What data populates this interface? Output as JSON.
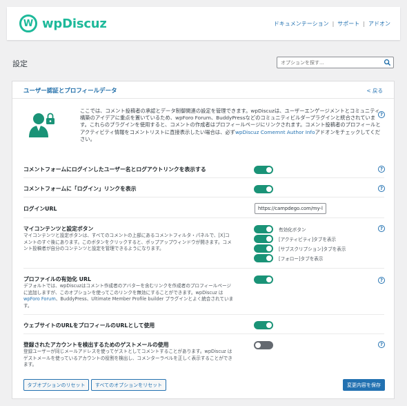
{
  "brand": {
    "name": "wpDiscuz",
    "logo_letter": "W",
    "color": "#1db99a"
  },
  "topnav": {
    "docs": "ドキュメンテーション",
    "support": "サポート",
    "addons": "アドオン"
  },
  "page": {
    "title": "設定",
    "search_placeholder": "オプションを探す..."
  },
  "panel": {
    "title": "ユーザー認証とプロフィールデータ",
    "back": "< 戻る",
    "intro": {
      "text": "ここでは、コメント投稿者の承認とデータ制御関連の設定を管理できます。wpDiscuzは、ユーザーエンゲージメントとコミュニティ構築のアイデアに重点を置いているため、wpForo Forum、BuddyPressなどのコミュニティビルダープラグインと統合されています。これらのプラグインを使用すると、コメントの作成者はプロフィールページにリンクされます。コメント投稿者のプロフィールとアクティビティ情報をコメントリストに直接表示したい場合は、必ず",
      "link": "wpDiscuz Comemnt Author Info",
      "suffix": "アドオンをチェックしてください。"
    }
  },
  "rows": {
    "r1": {
      "label": "コメントフォームにログインしたユーザー名とログアウトリンクを表示する",
      "enabled": true
    },
    "r2": {
      "label": "コメントフォームに「ログイン」リンクを表示",
      "enabled": true
    },
    "r3": {
      "label": "ログインURL",
      "value": "https://campdego.com/my-l"
    },
    "r4": {
      "label": "マイコンテンツと設定ボタン",
      "desc": "マイコンテンツと設定ボタンは、すべてのコメントの上部にあるコメントフィルタ・パネルで、[X]コメントのすぐ後にあります。このボタンをクリックすると、ポップアップウィンドウが開きます。コメント投稿者が自分のコンテンツと設定を管理できるようになります。",
      "options": [
        {
          "label": "有効化ボタン",
          "enabled": true
        },
        {
          "label": "[アクティビティ]タブを表示",
          "enabled": true
        },
        {
          "label": "[サブスクリプション]タブを表示",
          "enabled": true
        },
        {
          "label": "[フォロー]タブを表示",
          "enabled": true
        }
      ]
    },
    "r5": {
      "label": "プロファイルの有効化 URL",
      "desc_a": "デフォルトでは、wpDiscuzはコメント作成者のアバターを含むリンクを作成者のプロフィールページに追加しますが、このオプションを使ってこのリンクを無効にすることができます。wpDiscuz は",
      "desc_link": "wpForo Forum",
      "desc_b": "、BuddyPress、Ultimate Member Profile builder プラグインとよく統合されています。",
      "enabled": true
    },
    "r6": {
      "label": "ウェブサイトのURLをプロフィールのURLとして使用",
      "enabled": true
    },
    "r7": {
      "label": "登録されたアカウントを検出するためのゲストメールの使用",
      "desc": "登録ユーザーが同じメールアドレスを使ってゲストとしてコメントすることがあります。wpDiscuz はゲストメールを使っているアカウントの役割を検出し、コメンターラベルを正しく表示することができます。",
      "enabled": false
    }
  },
  "buttons": {
    "reset_tab": "タブオプションのリセット",
    "reset_all": "すべてのオプションをリセット",
    "save": "変更内容を保存"
  },
  "colors": {
    "toggle_on": "#1a9377",
    "toggle_off": "#646970",
    "link": "#2271b1"
  }
}
